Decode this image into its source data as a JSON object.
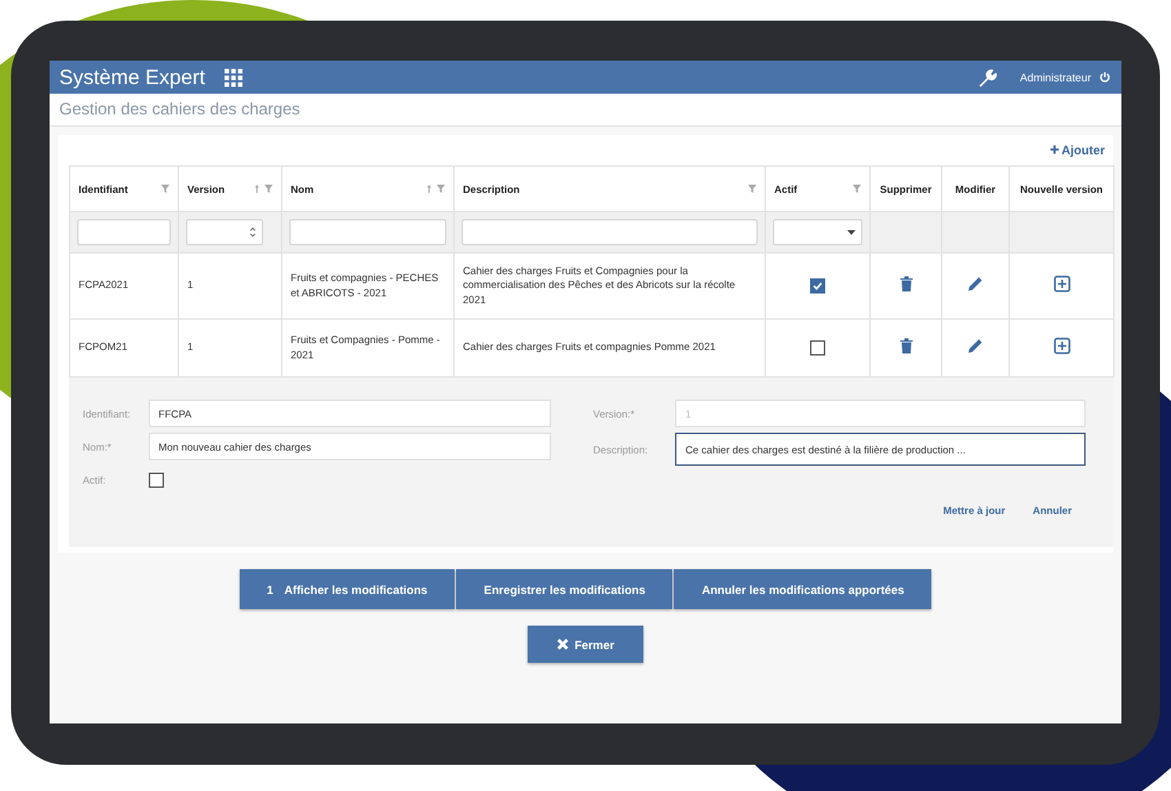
{
  "header": {
    "title": "Système Expert",
    "user": "Administrateur"
  },
  "subtitle": "Gestion des cahiers des charges",
  "add_link": "Ajouter",
  "filters": [
    {
      "kind": "text"
    },
    {
      "kind": "number"
    },
    {
      "kind": "text"
    },
    {
      "kind": "text"
    },
    {
      "kind": "select"
    },
    {
      "kind": "none"
    },
    {
      "kind": "none"
    },
    {
      "kind": "none"
    }
  ],
  "table": {
    "columns": [
      {
        "label": "Identifiant",
        "sortable": false,
        "filterable": true
      },
      {
        "label": "Version",
        "sortable": true,
        "filterable": true
      },
      {
        "label": "Nom",
        "sortable": true,
        "filterable": true
      },
      {
        "label": "Description",
        "sortable": false,
        "filterable": true
      },
      {
        "label": "Actif",
        "sortable": false,
        "filterable": true
      },
      {
        "label": "Supprimer",
        "sortable": false,
        "filterable": false
      },
      {
        "label": "Modifier",
        "sortable": false,
        "filterable": false
      },
      {
        "label": "Nouvelle version",
        "sortable": false,
        "filterable": false
      }
    ],
    "rows": [
      {
        "id": "FCPA2021",
        "version": "1",
        "name": "Fruits et compagnies - PECHES et ABRICOTS - 2021",
        "description": "Cahier des charges Fruits et Compagnies pour la commercialisation des Pêches et des Abricots sur la récolte 2021",
        "active": true
      },
      {
        "id": "FCPOM21",
        "version": "1",
        "name": "Fruits et Compagnies - Pomme - 2021",
        "description": "Cahier des charges Fruits et compagnies Pomme 2021",
        "active": false
      }
    ]
  },
  "form": {
    "fields": [
      {
        "label": "Identifiant:",
        "value": "FFCPA",
        "disabled": false,
        "focused": false
      },
      {
        "label": "Nom:*",
        "value": "Mon nouveau cahier des charges",
        "disabled": false,
        "focused": false
      },
      {
        "label": "Version:*",
        "value": "1",
        "disabled": true,
        "focused": false
      },
      {
        "label": "Description:",
        "value": "Ce cahier des charges est destiné à la filière de production ...",
        "disabled": false,
        "focused": true
      }
    ],
    "active_label": "Actif:",
    "active": false,
    "actions": [
      "Mettre à jour",
      "Annuler"
    ]
  },
  "buttons": [
    {
      "count": "1",
      "label": "Afficher les modifications"
    },
    {
      "label": "Enregistrer les modifications"
    },
    {
      "label": "Annuler les modifications apportées"
    }
  ],
  "close_button": "Fermer"
}
